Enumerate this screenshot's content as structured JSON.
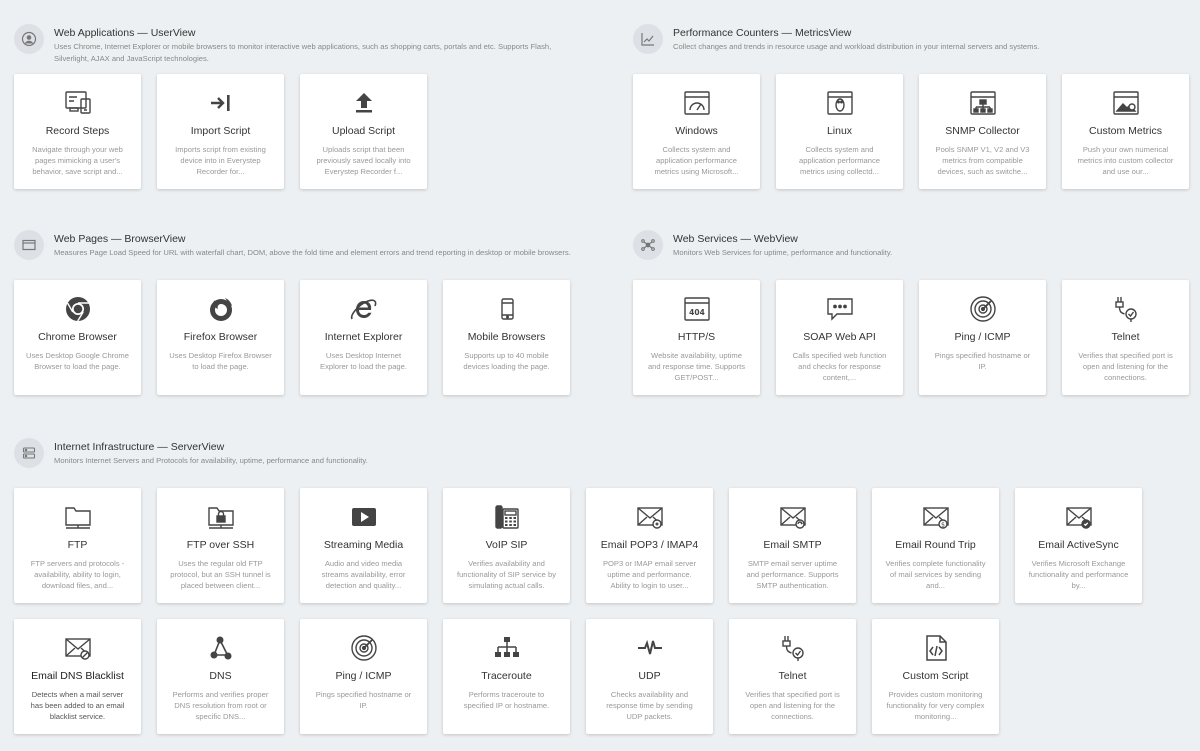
{
  "sections": {
    "userview": {
      "title": "Web Applications — UserView",
      "desc": "Uses Chrome, Internet Explorer or mobile browsers to monitor interactive web applications, such as shopping carts, portals and etc. Supports Flash, Silverlight, AJAX and JavaScript technologies.",
      "icon": "user-icon",
      "cards": [
        {
          "title": "Record Steps",
          "desc": "Navigate through your web pages mimicking a user's behavior, save script and...",
          "icon": "record-steps-icon"
        },
        {
          "title": "Import Script",
          "desc": "Imports script from existing device into in Everystep Recorder for...",
          "icon": "import-icon"
        },
        {
          "title": "Upload Script",
          "desc": "Uploads script that been previously saved locally into Everystep Recorder f...",
          "icon": "upload-icon"
        }
      ]
    },
    "metricsview": {
      "title": "Performance Counters — MetricsView",
      "desc": "Collect changes and trends in resource usage and workload distribution in your internal servers and systems.",
      "icon": "chart-icon",
      "cards": [
        {
          "title": "Windows",
          "desc": "Collects system and application performance metrics using Microsoft...",
          "icon": "gauge-window-icon"
        },
        {
          "title": "Linux",
          "desc": "Collects system and application performance metrics using collectd...",
          "icon": "linux-icon"
        },
        {
          "title": "SNMP Collector",
          "desc": "Pools SNMP V1, V2 and V3 metrics from compatible devices, such as switche...",
          "icon": "snmp-icon"
        },
        {
          "title": "Custom Metrics",
          "desc": "Push your own numerical metrics into custom collector and use our...",
          "icon": "custom-metrics-icon"
        }
      ]
    },
    "browserview": {
      "title": "Web Pages — BrowserView",
      "desc": "Measures Page Load Speed for URL with waterfall chart, DOM, above the fold time and element errors and trend reporting in desktop or mobile browsers.",
      "icon": "browser-window-icon",
      "cards": [
        {
          "title": "Chrome Browser",
          "desc": "Uses Desktop Google Chrome Browser to load the page.",
          "icon": "chrome-icon"
        },
        {
          "title": "Firefox Browser",
          "desc": "Uses Desktop Firefox Browser to load the page.",
          "icon": "firefox-icon"
        },
        {
          "title": "Internet Explorer",
          "desc": "Uses Desktop Internet Explorer to load the page.",
          "icon": "ie-icon"
        },
        {
          "title": "Mobile Browsers",
          "desc": "Supports up to 40 mobile devices loading the page.",
          "icon": "mobile-icon"
        }
      ]
    },
    "webview": {
      "title": "Web Services — WebView",
      "desc": "Monitors Web Services for uptime, performance and functionality.",
      "icon": "network-icon",
      "cards": [
        {
          "title": "HTTP/S",
          "desc": "Website availability, uptime and response time. Supports GET/POST...",
          "icon": "http-404-icon"
        },
        {
          "title": "SOAP Web API",
          "desc": "Calls specified web function and checks for response content,...",
          "icon": "soap-icon"
        },
        {
          "title": "Ping / ICMP",
          "desc": "Pings specified hostname or IP.",
          "icon": "ping-radar-icon"
        },
        {
          "title": "Telnet",
          "desc": "Verifies that specified port is open and listening for the connections.",
          "icon": "telnet-icon"
        }
      ]
    },
    "serverview": {
      "title": "Internet Infrastructure — ServerView",
      "desc": "Monitors Internet Servers and Protocols for availability, uptime, performance and functionality.",
      "icon": "server-icon",
      "cards": [
        {
          "title": "FTP",
          "desc": "FTP servers and protocols - availability, ability to login, download files, and...",
          "icon": "folder-icon"
        },
        {
          "title": "FTP over SSH",
          "desc": "Uses the regular old FTP protocol, but an SSH tunnel is placed between client...",
          "icon": "folder-lock-icon"
        },
        {
          "title": "Streaming Media",
          "desc": "Audio and video media streams availability, error detection and quality...",
          "icon": "video-play-icon"
        },
        {
          "title": "VoIP SIP",
          "desc": "Verifies availability and functionality of SIP service by simulating actual calls.",
          "icon": "phone-icon"
        },
        {
          "title": "Email POP3 / IMAP4",
          "desc": "POP3 or IMAP email server uptime and performance. Ability to login to user...",
          "icon": "email-pop3-icon"
        },
        {
          "title": "Email SMTP",
          "desc": "SMTP email server uptime and performance. Supports SMTP authentication.",
          "icon": "email-smtp-icon"
        },
        {
          "title": "Email Round Trip",
          "desc": "Verifies complete functionality of mail services by sending and...",
          "icon": "email-roundtrip-icon"
        },
        {
          "title": "Email ActiveSync",
          "desc": "Verifies Microsoft Exchange functionality and performance by...",
          "icon": "email-activesync-icon"
        },
        {
          "title": "Email DNS Blacklist",
          "desc": "Detects when a mail server has been added to an email blacklist service.",
          "icon": "email-blacklist-icon"
        },
        {
          "title": "DNS",
          "desc": "Performs and verifies proper DNS resolution from root or specific DNS...",
          "icon": "dns-icon"
        },
        {
          "title": "Ping / ICMP",
          "desc": "Pings specified hostname or IP.",
          "icon": "ping-radar-icon"
        },
        {
          "title": "Traceroute",
          "desc": "Performs traceroute to specified IP or hostname.",
          "icon": "traceroute-icon"
        },
        {
          "title": "UDP",
          "desc": "Checks availability and response time by sending UDP packets.",
          "icon": "udp-pulse-icon"
        },
        {
          "title": "Telnet",
          "desc": "Verifies that specified port is open and listening for the connections.",
          "icon": "telnet-icon"
        },
        {
          "title": "Custom Script",
          "desc": "Provides custom monitoring functionality for very complex monitoring...",
          "icon": "script-file-icon"
        }
      ]
    }
  },
  "colors": {
    "background": "#edf0f2",
    "card": "#ffffff",
    "icon": "#444444",
    "title": "#333333",
    "desc": "#999999"
  }
}
